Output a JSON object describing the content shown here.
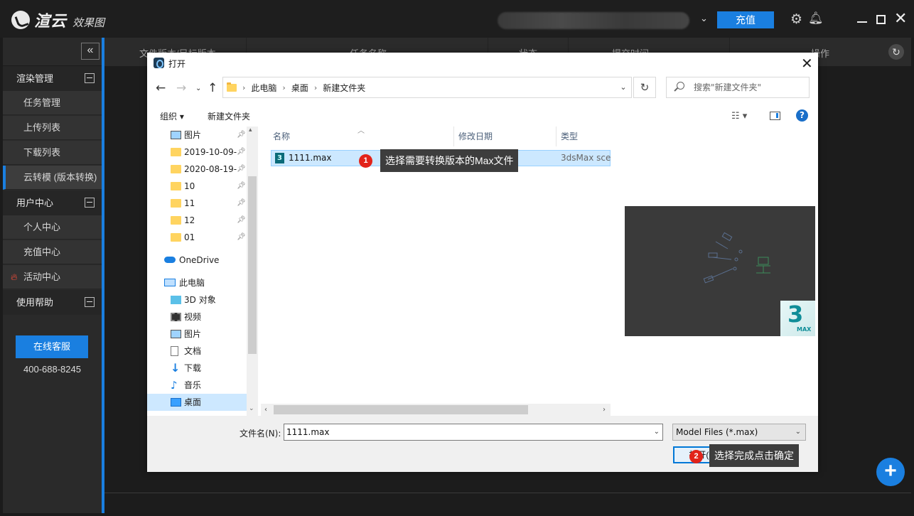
{
  "app": {
    "brand": "渲云",
    "brand_sub": "效果图",
    "recharge_label": "充值"
  },
  "sidebar": {
    "groups": [
      {
        "label": "渲染管理",
        "items": [
          "任务管理",
          "上传列表",
          "下载列表",
          "云转模 (版本转换)"
        ]
      },
      {
        "label": "用户中心",
        "items": [
          "个人中心",
          "充值中心",
          "活动中心"
        ]
      },
      {
        "label": "使用帮助",
        "items": []
      }
    ],
    "service_button": "在线客服",
    "phone": "400-688-8245"
  },
  "table_headers": [
    "文件版本/目标版本",
    "任务名称",
    "状态",
    "提交时间",
    "操作"
  ],
  "dialog": {
    "title": "打开",
    "breadcrumbs": [
      "此电脑",
      "桌面",
      "新建文件夹"
    ],
    "search_placeholder": "搜索\"新建文件夹\"",
    "organize_label": "组织 ▾",
    "new_folder_label": "新建文件夹",
    "tree": [
      {
        "label": "图片",
        "icon": "picture",
        "pinned": true
      },
      {
        "label": "2019-10-09-",
        "icon": "folder",
        "pinned": true
      },
      {
        "label": "2020-08-19-",
        "icon": "folder",
        "pinned": true
      },
      {
        "label": "10",
        "icon": "folder",
        "pinned": true
      },
      {
        "label": "11",
        "icon": "folder",
        "pinned": true
      },
      {
        "label": "12",
        "icon": "folder",
        "pinned": true
      },
      {
        "label": "01",
        "icon": "folder",
        "pinned": true
      },
      {
        "label": "OneDrive",
        "icon": "cloud"
      },
      {
        "label": "此电脑",
        "icon": "pc"
      },
      {
        "label": "3D 对象",
        "icon": "3d"
      },
      {
        "label": "视频",
        "icon": "video"
      },
      {
        "label": "图片",
        "icon": "picture"
      },
      {
        "label": "文档",
        "icon": "document"
      },
      {
        "label": "下载",
        "icon": "download"
      },
      {
        "label": "音乐",
        "icon": "music"
      },
      {
        "label": "桌面",
        "icon": "desktop",
        "selected": true
      }
    ],
    "columns": [
      "名称",
      "修改日期",
      "类型"
    ],
    "files": [
      {
        "name": "1111.max",
        "type": "3dsMax sce"
      }
    ],
    "filename_label": "文件名(N):",
    "filename_value": "1111.max",
    "filetype_value": "Model Files (*.max)",
    "open_label": "打开(O)",
    "preview_logo": "3",
    "preview_logo_sub": "MAX"
  },
  "annotations": [
    {
      "num": "1",
      "text": "选择需要转换版本的Max文件"
    },
    {
      "num": "2",
      "text": "选择完成点击确定"
    }
  ]
}
